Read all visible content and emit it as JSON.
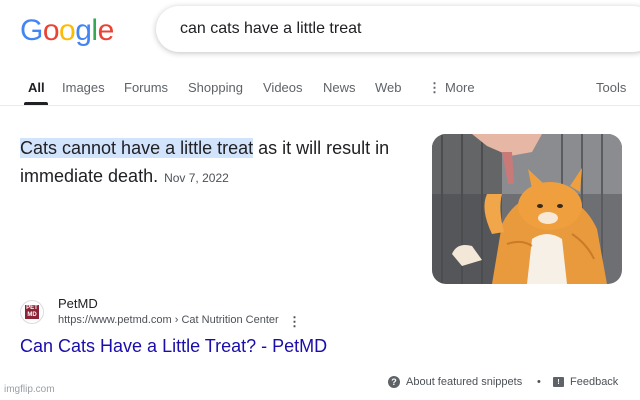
{
  "header": {
    "logo_letters": [
      {
        "char": "G",
        "color": "#4285f4"
      },
      {
        "char": "o",
        "color": "#ea4335"
      },
      {
        "char": "o",
        "color": "#fbbc05"
      },
      {
        "char": "g",
        "color": "#4285f4"
      },
      {
        "char": "l",
        "color": "#34a853"
      },
      {
        "char": "e",
        "color": "#ea4335"
      }
    ],
    "search_query": "can cats have a little treat"
  },
  "tabs": {
    "items": [
      "All",
      "Images",
      "Forums",
      "Shopping",
      "Videos",
      "News",
      "Web",
      "More"
    ],
    "more_icon": "vertical-dots-icon",
    "tools": "Tools"
  },
  "featured_snippet": {
    "highlighted": "Cats cannot have a little treat",
    "rest_line1": " as it will result in",
    "rest_line2": "immediate death.",
    "date": "Nov 7, 2022",
    "image_icon": "orange-cat-photo"
  },
  "result": {
    "favicon_text": "PET MD",
    "site_name": "PetMD",
    "url": "https://www.petmd.com › Cat Nutrition Center",
    "menu_icon": "kebab-icon",
    "title": "Can Cats Have a Little Treat? - PetMD"
  },
  "footer": {
    "about": "About featured snippets",
    "separator": "•",
    "feedback": "Feedback"
  },
  "watermark": "imgflip.com",
  "colors": {
    "link": "#1a0dab",
    "highlight": "#d2e3fc",
    "muted": "#5f6368"
  }
}
